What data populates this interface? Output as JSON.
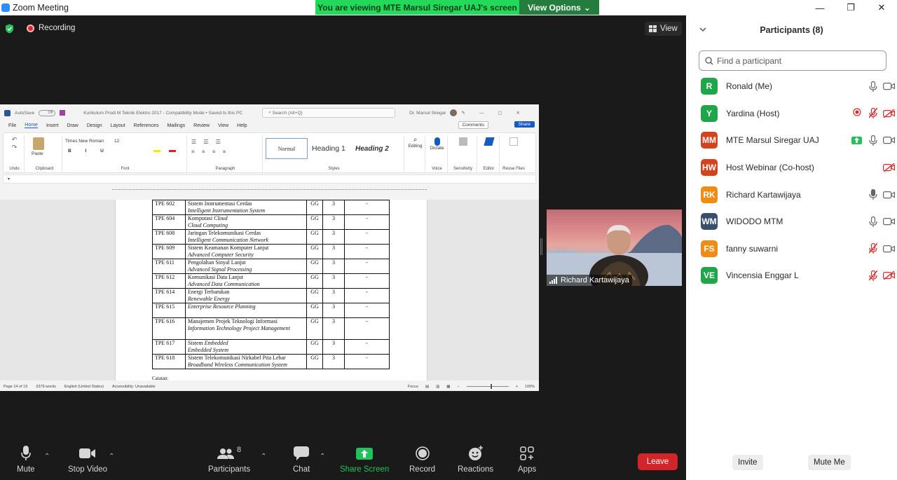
{
  "window": {
    "title": "Zoom Meeting",
    "controls": [
      "—",
      "❐",
      "✕"
    ]
  },
  "share_banner": {
    "viewing": "You are viewing MTE Marsul Siregar UAJ's screen",
    "view_options": "View Options"
  },
  "meeting": {
    "recording": "Recording",
    "view": "View"
  },
  "word": {
    "autosave": "AutoSave",
    "autosave_state": "Off",
    "doc_name": "Kurikulum Prodi M Teknik Elektro 2017 - Compatibility Mode • Saved to this PC",
    "search_placeholder": "Search (Alt+Q)",
    "user": "Dr. Marsul Siregar",
    "menus": [
      "File",
      "Home",
      "Insert",
      "Draw",
      "Design",
      "Layout",
      "References",
      "Mailings",
      "Review",
      "View",
      "Help"
    ],
    "comments": "Comments",
    "share": "Share",
    "ribbon": {
      "undo": "Undo",
      "paste": "Paste",
      "clipboard": "Clipboard",
      "font_name": "Times New Roman",
      "font_size": "12",
      "font": "Font",
      "paragraph": "Paragraph",
      "styles_label": "Styles",
      "styles": [
        "Normal",
        "Heading 1",
        "Heading 2"
      ],
      "editing": "Editing",
      "dictate": "Dictate",
      "voice": "Voice",
      "sensitivity": "Sensitivity",
      "editor": "Editor",
      "reuse_files": "Reuse Files"
    },
    "table_rows": [
      {
        "code": "TPE 602",
        "id": "Sistem Instrumentasi Cerdas",
        "en": "Intelligent Instrumentation System",
        "grp": "GG",
        "sks": "3",
        "pre": "-"
      },
      {
        "code": "TPE 604",
        "id": "Komputasi ",
        "id_em": "Cloud",
        "en": "Cloud Computing",
        "grp": "GG",
        "sks": "3",
        "pre": "-"
      },
      {
        "code": "TPE 608",
        "id": "Jaringan Telekomunikasi Cerdas",
        "en": "Intelligent Communication Network",
        "grp": "GG",
        "sks": "3",
        "pre": "-"
      },
      {
        "code": "TPE 609",
        "id": "Sistem Keamanan Komputer Lanjut",
        "en": "Advanced Computer Security",
        "grp": "GG",
        "sks": "3",
        "pre": "-"
      },
      {
        "code": "TPE 611",
        "id": "Pengolahan Sinyal Lanjut",
        "en": "Advanced Signal Processing",
        "grp": "GG",
        "sks": "3",
        "pre": "-"
      },
      {
        "code": "TPE 612",
        "id": "Komunikasi Data Lanjut",
        "en": "Advanced Data Communication",
        "grp": "GG",
        "sks": "3",
        "pre": "-"
      },
      {
        "code": "TPE 614",
        "id": "Energi Terbarukan",
        "en": "Renewable Energy",
        "grp": "GG",
        "sks": "3",
        "pre": "-"
      },
      {
        "code": "TPE 615",
        "id": "",
        "en": "Enterprise Resource Planning",
        "grp": "GG",
        "sks": "3",
        "pre": "-"
      },
      {
        "code": "TPE 616",
        "id": "Manajemen Projek Teknologi Informasi",
        "en": "Information Technology Project Management",
        "grp": "GG",
        "sks": "3",
        "pre": "-"
      },
      {
        "code": "TPE 617",
        "id": "Sistem ",
        "id_em": "Embedded",
        "en": "Embedded System",
        "grp": "GG",
        "sks": "3",
        "pre": "-"
      },
      {
        "code": "TPE 618",
        "id": "Sistem Telekomunikasi Nirkabel Pita Lebar",
        "en": "Broadband Wireless Communication System",
        "grp": "GG",
        "sks": "3",
        "pre": "-"
      }
    ],
    "catatan": "Catatan:",
    "status": {
      "page": "Page 14 of 19",
      "words": "3379 words",
      "language": "English (United States)",
      "accessibility": "Accessibility: Unavailable",
      "focus": "Focus",
      "zoom": "100%"
    }
  },
  "video": {
    "name": "Richard Kartawijaya"
  },
  "toolbar": {
    "mute": "Mute",
    "stop_video": "Stop Video",
    "participants": "Participants",
    "participants_count": "8",
    "chat": "Chat",
    "share_screen": "Share Screen",
    "record": "Record",
    "reactions": "Reactions",
    "apps": "Apps",
    "leave": "Leave"
  },
  "panel": {
    "title": "Participants (8)",
    "search_placeholder": "Find a participant",
    "invite": "Invite",
    "mute_me": "Mute Me",
    "participants": [
      {
        "initials": "R",
        "name": "Ronald (Me)",
        "color": "#1fa64a",
        "share": false,
        "rec": false,
        "mic": "on",
        "cam": "on"
      },
      {
        "initials": "Y",
        "name": "Yardina (Host)",
        "color": "#1fa64a",
        "share": false,
        "rec": true,
        "mic": "muted",
        "cam": "off"
      },
      {
        "initials": "MM",
        "name": "MTE Marsul Siregar UAJ",
        "color": "#d2431f",
        "share": true,
        "rec": false,
        "mic": "on",
        "cam": "on"
      },
      {
        "initials": "HW",
        "name": "Host Webinar (Co-host)",
        "color": "#d2431f",
        "share": false,
        "rec": false,
        "mic": "none",
        "cam": "off"
      },
      {
        "initials": "RK",
        "name": "Richard Kartawijaya",
        "color": "#f08c14",
        "share": false,
        "rec": false,
        "mic": "active",
        "cam": "on"
      },
      {
        "initials": "WM",
        "name": "WIDODO MTM",
        "color": "#3a4f6a",
        "share": false,
        "rec": false,
        "mic": "on",
        "cam": "on"
      },
      {
        "initials": "FS",
        "name": "fanny suwarni",
        "color": "#f08c14",
        "share": false,
        "rec": false,
        "mic": "muted",
        "cam": "on"
      },
      {
        "initials": "VE",
        "name": "Vincensia Enggar L",
        "color": "#1fa64a",
        "share": false,
        "rec": false,
        "mic": "muted",
        "cam": "off"
      }
    ]
  }
}
